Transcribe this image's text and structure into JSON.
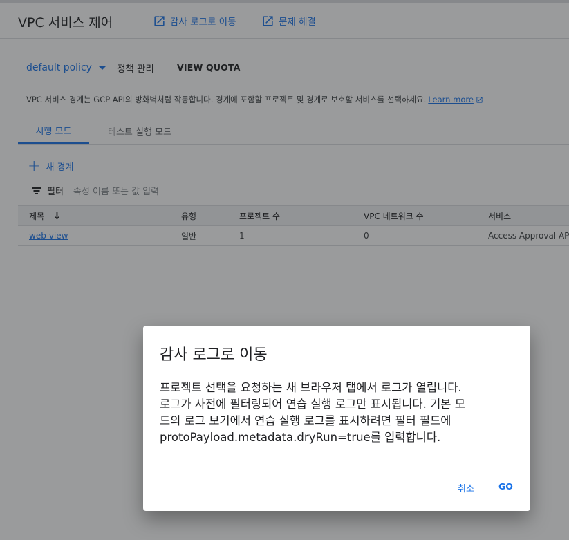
{
  "header": {
    "title": "VPC 서비스 제어",
    "links": [
      {
        "label": "감사 로그로 이동",
        "icon": "open-in-new-icon"
      },
      {
        "label": "문제 해결",
        "icon": "open-in-new-icon"
      }
    ]
  },
  "policy_bar": {
    "selected_policy": "default policy",
    "manage_label": "정책 관리",
    "quota_label": "VIEW QUOTA"
  },
  "description": {
    "text": "VPC 서비스 경계는 GCP API의 방화벽처럼 작동합니다. 경계에 포함할 프로젝트 및 경계로 보호할 서비스를 선택하세요.",
    "learn_more": "Learn more"
  },
  "tabs": [
    {
      "label": "시행 모드",
      "active": true
    },
    {
      "label": "테스트 실행 모드",
      "active": false
    }
  ],
  "actions": {
    "new_perimeter": "새 경계"
  },
  "filter": {
    "label": "필터",
    "placeholder": "속성 이름 또는 값 입력"
  },
  "table": {
    "columns": [
      "제목",
      "유형",
      "프로젝트 수",
      "VPC 네트워크 수",
      "서비스"
    ],
    "rows": [
      [
        "web-view",
        "일반",
        "1",
        "0",
        "Access Approval AP"
      ]
    ]
  },
  "dialog": {
    "title": "감사 로그로 이동",
    "body_lines": [
      "프로젝트 선택을 요청하는 새 브라우저 탭에서 로그가 열립니다.",
      "로그가 사전에 필터링되어 연습 실행 로그만 표시됩니다. 기본 모",
      "드의 로그 보기에서 연습 실행 로그를 표시하려면 필터 필드에",
      "protoPayload.metadata.dryRun=true를 입력합니다."
    ],
    "cancel_label": "취소",
    "go_label": "GO"
  },
  "colors": {
    "accent": "#1a73e8",
    "scrim": "rgba(32,33,36,0.45)"
  }
}
